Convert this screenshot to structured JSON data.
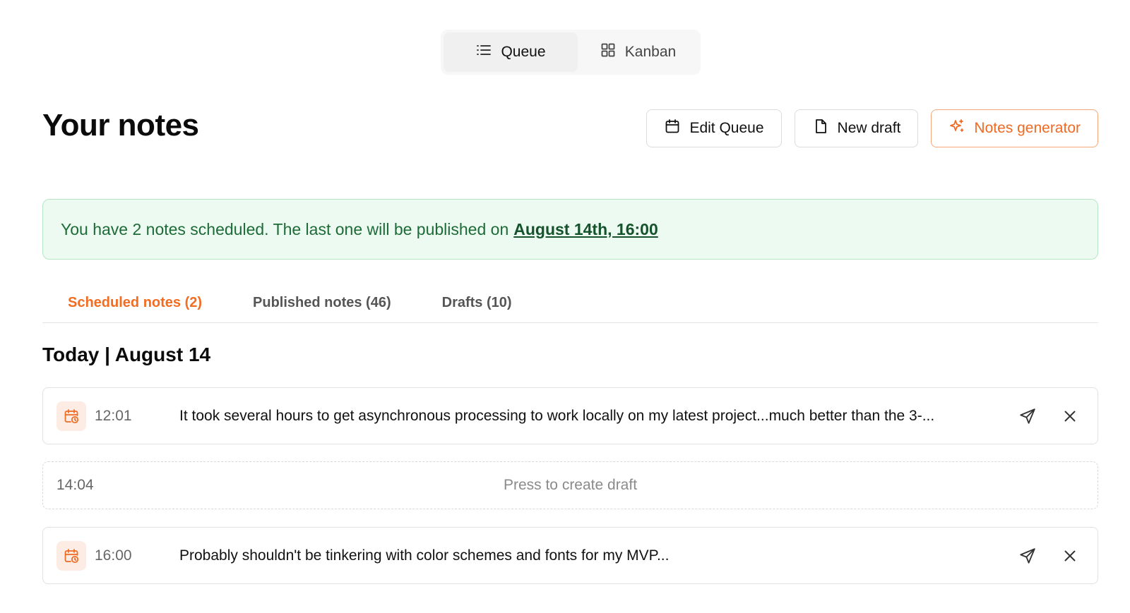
{
  "view_toggle": {
    "queue_label": "Queue",
    "kanban_label": "Kanban",
    "active": "Queue"
  },
  "header": {
    "title": "Your notes",
    "edit_queue_label": "Edit Queue",
    "new_draft_label": "New draft",
    "notes_generator_label": "Notes generator"
  },
  "banner": {
    "text": "You have 2 notes scheduled. The last one will be published on",
    "link": "August 14th, 16:00"
  },
  "tabs": [
    {
      "label": "Scheduled notes (2)",
      "active": true
    },
    {
      "label": "Published notes (46)",
      "active": false
    },
    {
      "label": "Drafts (10)",
      "active": false
    }
  ],
  "section": {
    "title": "Today | August 14"
  },
  "rows": [
    {
      "type": "scheduled",
      "time": "12:01",
      "text": "It took several hours to get asynchronous processing to work locally on my latest project...much better than the 3-..."
    },
    {
      "type": "empty",
      "time": "14:04",
      "hint": "Press to create draft"
    },
    {
      "type": "scheduled",
      "time": "16:00",
      "text": "Probably shouldn't be tinkering with color schemes and fonts for my MVP..."
    }
  ],
  "colors": {
    "accent": "#f26d21",
    "banner_bg": "#edfaf1",
    "banner_text": "#1d6b36"
  },
  "icons": {
    "queue": "list-icon",
    "kanban": "grid-icon",
    "edit_queue": "calendar-icon",
    "new_draft": "document-icon",
    "notes_generator": "sparkles-icon",
    "scheduled": "calendar-clock-icon",
    "send": "send-icon",
    "close": "close-icon"
  }
}
